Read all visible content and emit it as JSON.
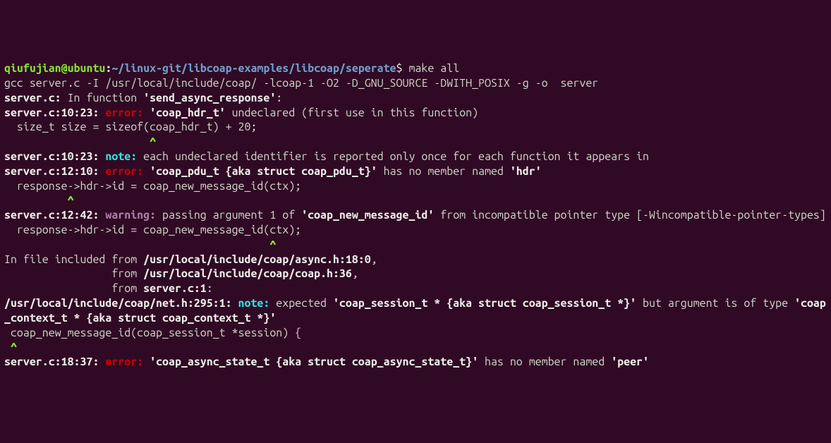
{
  "prompt": {
    "user": "qiufujian@ubuntu",
    "sep1": ":",
    "path": "~/linux-git/libcoap-examples/libcoap/seperate",
    "sep2": "$ ",
    "cmd": "make all"
  },
  "l2": "gcc server.c -I /usr/local/include/coap/ -lcoap-1 -O2 -D_GNU_SOURCE -DWITH_POSIX -g -o  server",
  "l3": {
    "a": "server.c:",
    "b": " In function ",
    "c": "'send_async_response'",
    "d": ":"
  },
  "l4": {
    "loc": "server.c:10:23: ",
    "tag": "error: ",
    "q1": "'coap_hdr_t'",
    "rest": " undeclared (first use in this function)"
  },
  "l5": "  size_t size = sizeof(coap_hdr_t) + 20;",
  "l5caret": "                       ^",
  "l6": {
    "loc": "server.c:10:23: ",
    "tag": "note: ",
    "rest": "each undeclared identifier is reported only once for each function it appears in"
  },
  "l7": {
    "loc": "server.c:12:10: ",
    "tag": "error: ",
    "q1": "'coap_pdu_t {aka struct coap_pdu_t}'",
    "mid": " has no member named ",
    "q2": "'hdr'"
  },
  "l8": "  response->hdr->id = coap_new_message_id(ctx);",
  "l8caret": "          ^",
  "l9": {
    "loc": "server.c:12:42: ",
    "tag": "warning: ",
    "a": "passing argument 1 of ",
    "q1": "'coap_new_message_id'",
    "b": " from incompatible pointer type [-Wincompatible-pointer-types]"
  },
  "l10": "  response->hdr->id = coap_new_message_id(ctx);",
  "l10caret": "                                          ^",
  "l11": {
    "a": "In file included from ",
    "p": "/usr/local/include/coap/async.h:18:0",
    "c": ","
  },
  "l12": {
    "a": "                 from ",
    "p": "/usr/local/include/coap/coap.h:36",
    "c": ","
  },
  "l13": {
    "a": "                 from ",
    "p": "server.c:1",
    "c": ":"
  },
  "l14": {
    "loc": "/usr/local/include/coap/net.h:295:1: ",
    "tag": "note: ",
    "a": "expected ",
    "q1": "'coap_session_t * {aka struct coap_session_t *}'",
    "b": " but argument is of type ",
    "q2": "'coap_context_t * {aka struct coap_context_t *}'"
  },
  "l15": " coap_new_message_id(coap_session_t *session) {",
  "l15caret": " ^",
  "l16": {
    "loc": "server.c:18:37: ",
    "tag": "error: ",
    "q1": "'coap_async_state_t {aka struct coap_async_state_t}'",
    "mid": " has no member named ",
    "q2": "'peer'"
  }
}
